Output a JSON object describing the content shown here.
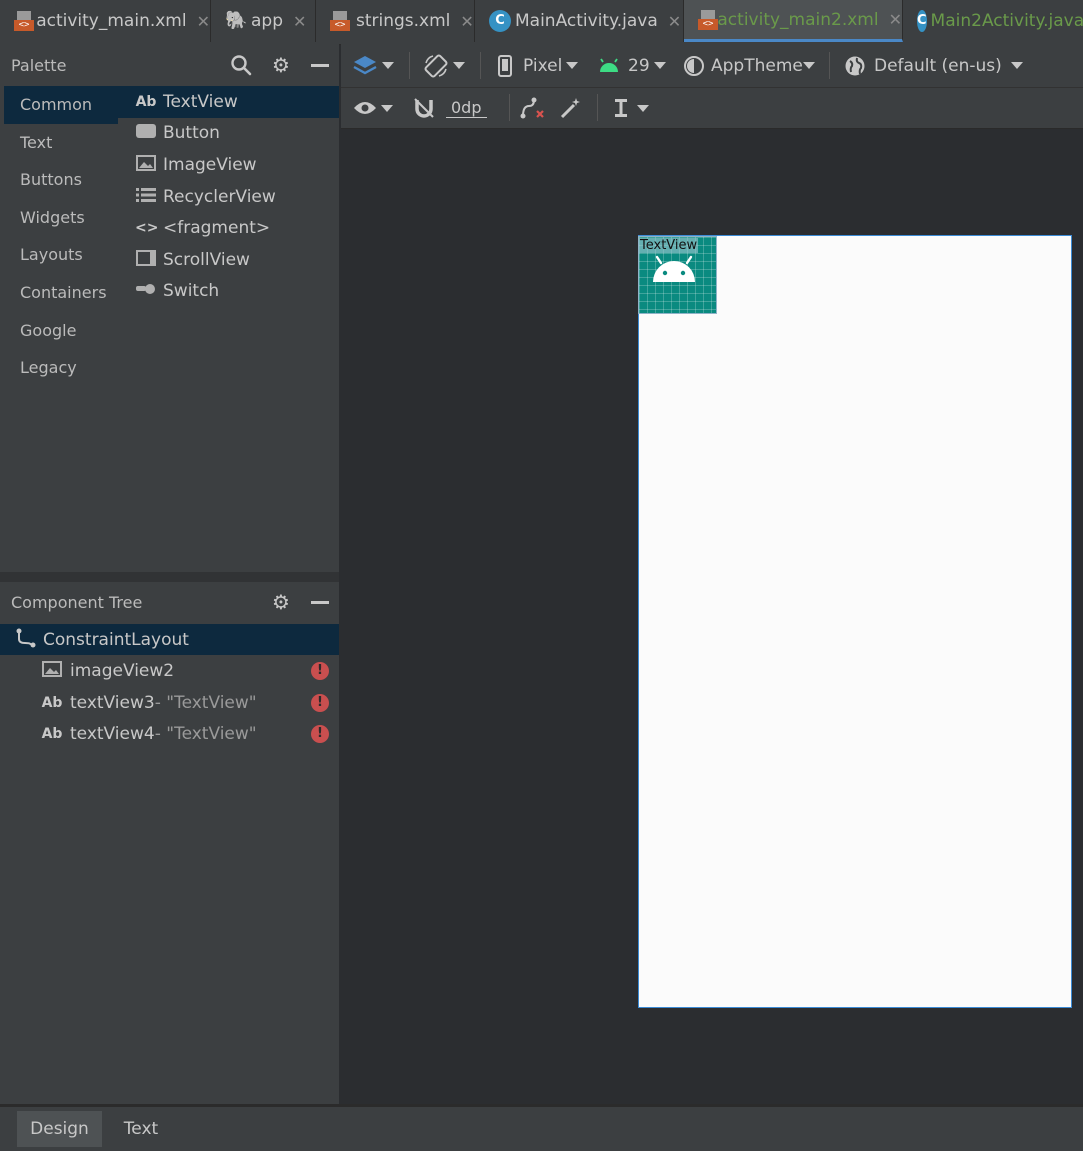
{
  "tabs": [
    {
      "label": "activity_main.xml",
      "icon": "xml-file-icon",
      "active": false
    },
    {
      "label": "app",
      "icon": "gradle-icon",
      "active": false
    },
    {
      "label": "strings.xml",
      "icon": "xml-file-icon",
      "active": false
    },
    {
      "label": "MainActivity.java",
      "icon": "java-class-icon",
      "active": false
    },
    {
      "label": "activity_main2.xml",
      "icon": "xml-file-icon",
      "active": true
    },
    {
      "label": "Main2Activity.java",
      "icon": "java-class-icon",
      "active": false
    }
  ],
  "palette": {
    "title": "Palette",
    "categories": [
      "Common",
      "Text",
      "Buttons",
      "Widgets",
      "Layouts",
      "Containers",
      "Google",
      "Legacy"
    ],
    "selected_category": "Common",
    "items": [
      {
        "label": "TextView",
        "icon": "textview-icon",
        "glyph": "Ab"
      },
      {
        "label": "Button",
        "icon": "button-icon",
        "glyph": ""
      },
      {
        "label": "ImageView",
        "icon": "image-icon",
        "glyph": ""
      },
      {
        "label": "RecyclerView",
        "icon": "list-icon",
        "glyph": ""
      },
      {
        "label": "<fragment>",
        "icon": "code-brackets-icon",
        "glyph": "<>"
      },
      {
        "label": "ScrollView",
        "icon": "scrollview-icon",
        "glyph": ""
      },
      {
        "label": "Switch",
        "icon": "switch-icon",
        "glyph": ""
      }
    ],
    "selected_item": "TextView"
  },
  "component_tree": {
    "title": "Component Tree",
    "root": "ConstraintLayout",
    "children": [
      {
        "name": "imageView2",
        "text": "",
        "icon": "image-icon",
        "error": true
      },
      {
        "name": "textView3",
        "text": "- \"TextView\"",
        "icon": "textview-icon",
        "error": true
      },
      {
        "name": "textView4",
        "text": "- \"TextView\"",
        "icon": "textview-icon",
        "error": true
      }
    ]
  },
  "toolbar": {
    "device": "Pixel",
    "api": "29",
    "theme": "AppTheme",
    "locale": "Default (en-us)",
    "margin": "0dp"
  },
  "canvas": {
    "textview_label": "TextView"
  },
  "bottom_tabs": [
    "Design",
    "Text"
  ],
  "colors": {
    "accent": "#4a88c7",
    "error": "#c94f4f",
    "active_tab_text": "#6a9a4a",
    "android_green": "#3ddc84",
    "imageview_teal": "#0a8a80"
  }
}
